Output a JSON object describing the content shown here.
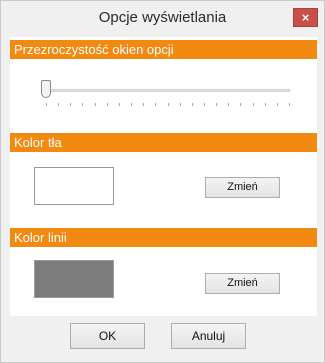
{
  "window": {
    "title": "Opcje wyświetlania",
    "close_glyph": "×"
  },
  "sections": {
    "transparency": {
      "header": "Przezroczystość okien opcji",
      "slider_value": 0
    },
    "background": {
      "header": "Kolor tła",
      "swatch_color": "#ffffff",
      "button_label": "Zmień"
    },
    "line": {
      "header": "Kolor linii",
      "swatch_color": "#7c7c7c",
      "button_label": "Zmień"
    }
  },
  "footer": {
    "ok_label": "OK",
    "cancel_label": "Anuluj"
  },
  "colors": {
    "accent": "#f28a12",
    "close_button": "#c8504a"
  }
}
